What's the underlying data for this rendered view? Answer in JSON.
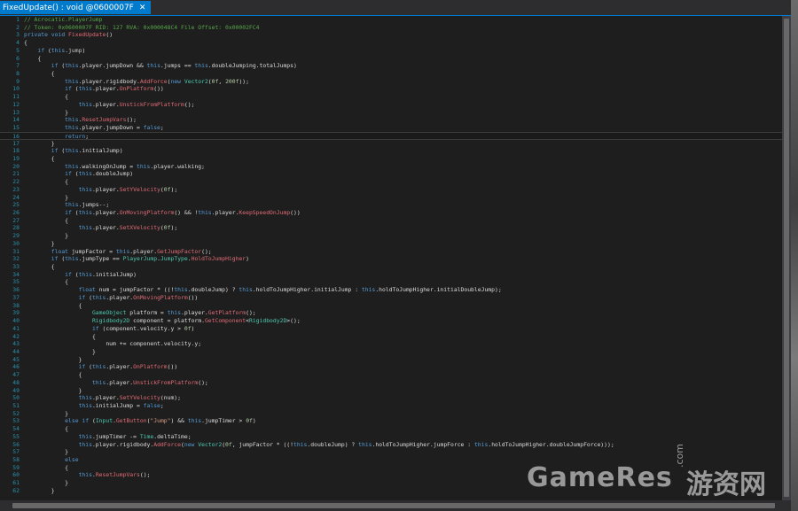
{
  "tab": {
    "title": "FixedUpdate() : void @0600007F",
    "close": "✕"
  },
  "colors": {
    "keyword": "#569cd6",
    "comment": "#57a64a",
    "method": "#e06c75",
    "type": "#4ec9b0",
    "string": "#d69d85",
    "number": "#b5cea8",
    "line_number": "#2b91af",
    "text": "#dcdcdc",
    "accent": "#007acc"
  },
  "current_line": 16,
  "watermark": {
    "text": "GameRes",
    "com": ".com",
    "cn": "游资网"
  },
  "lines": [
    [
      [
        "cm",
        "// Acrocatic.PlayerJump"
      ]
    ],
    [
      [
        "cm",
        "// Token: 0x0600007F RID: 127 RVA: 0x000048C4 File Offset: 0x00002FC4"
      ]
    ],
    [
      [
        "kw",
        "private "
      ],
      [
        "kw",
        "void "
      ],
      [
        "mt",
        "FixedUpdate"
      ],
      [
        "pl",
        "()"
      ]
    ],
    [
      [
        "pl",
        "{"
      ]
    ],
    [
      [
        "pl",
        "    "
      ],
      [
        "kw",
        "if "
      ],
      [
        "pl",
        "("
      ],
      [
        "kw",
        "this"
      ],
      [
        "pl",
        "."
      ],
      [
        "fd",
        "jump"
      ],
      [
        "pl",
        ")"
      ]
    ],
    [
      [
        "pl",
        "    {"
      ]
    ],
    [
      [
        "pl",
        "        "
      ],
      [
        "kw",
        "if "
      ],
      [
        "pl",
        "("
      ],
      [
        "kw",
        "this"
      ],
      [
        "pl",
        ".player.jumpDown && "
      ],
      [
        "kw",
        "this"
      ],
      [
        "pl",
        ".jumps == "
      ],
      [
        "kw",
        "this"
      ],
      [
        "pl",
        ".doubleJumping.totalJumps)"
      ]
    ],
    [
      [
        "pl",
        "        {"
      ]
    ],
    [
      [
        "pl",
        "            "
      ],
      [
        "kw",
        "this"
      ],
      [
        "pl",
        ".player.rigidbody."
      ],
      [
        "mt",
        "AddForce"
      ],
      [
        "pl",
        "("
      ],
      [
        "kw",
        "new "
      ],
      [
        "ty",
        "Vector2"
      ],
      [
        "pl",
        "("
      ],
      [
        "nm",
        "0f"
      ],
      [
        "pl",
        ", "
      ],
      [
        "nm",
        "200f"
      ],
      [
        "pl",
        "));"
      ]
    ],
    [
      [
        "pl",
        "            "
      ],
      [
        "kw",
        "if "
      ],
      [
        "pl",
        "("
      ],
      [
        "kw",
        "this"
      ],
      [
        "pl",
        ".player."
      ],
      [
        "mt",
        "OnPlatform"
      ],
      [
        "pl",
        "())"
      ]
    ],
    [
      [
        "pl",
        "            {"
      ]
    ],
    [
      [
        "pl",
        "                "
      ],
      [
        "kw",
        "this"
      ],
      [
        "pl",
        ".player."
      ],
      [
        "mt",
        "UnstickFromPlatform"
      ],
      [
        "pl",
        "();"
      ]
    ],
    [
      [
        "pl",
        "            }"
      ]
    ],
    [
      [
        "pl",
        "            "
      ],
      [
        "kw",
        "this"
      ],
      [
        "pl",
        "."
      ],
      [
        "mt",
        "ResetJumpVars"
      ],
      [
        "pl",
        "();"
      ]
    ],
    [
      [
        "pl",
        "            "
      ],
      [
        "kw",
        "this"
      ],
      [
        "pl",
        ".player.jumpDown = "
      ],
      [
        "kw",
        "false"
      ],
      [
        "pl",
        ";"
      ]
    ],
    [
      [
        "pl",
        "            "
      ],
      [
        "kw",
        "return"
      ],
      [
        "pl",
        ";"
      ]
    ],
    [
      [
        "pl",
        "        }"
      ]
    ],
    [
      [
        "pl",
        "        "
      ],
      [
        "kw",
        "if "
      ],
      [
        "pl",
        "("
      ],
      [
        "kw",
        "this"
      ],
      [
        "pl",
        ".initialJump)"
      ]
    ],
    [
      [
        "pl",
        "        {"
      ]
    ],
    [
      [
        "pl",
        "            "
      ],
      [
        "kw",
        "this"
      ],
      [
        "pl",
        ".walkingOnJump = "
      ],
      [
        "kw",
        "this"
      ],
      [
        "pl",
        ".player.walking;"
      ]
    ],
    [
      [
        "pl",
        "            "
      ],
      [
        "kw",
        "if "
      ],
      [
        "pl",
        "("
      ],
      [
        "kw",
        "this"
      ],
      [
        "pl",
        ".doubleJump)"
      ]
    ],
    [
      [
        "pl",
        "            {"
      ]
    ],
    [
      [
        "pl",
        "                "
      ],
      [
        "kw",
        "this"
      ],
      [
        "pl",
        ".player."
      ],
      [
        "mt",
        "SetYVelocity"
      ],
      [
        "pl",
        "("
      ],
      [
        "nm",
        "0f"
      ],
      [
        "pl",
        ");"
      ]
    ],
    [
      [
        "pl",
        "            }"
      ]
    ],
    [
      [
        "pl",
        "            "
      ],
      [
        "kw",
        "this"
      ],
      [
        "pl",
        ".jumps--;"
      ]
    ],
    [
      [
        "pl",
        "            "
      ],
      [
        "kw",
        "if "
      ],
      [
        "pl",
        "("
      ],
      [
        "kw",
        "this"
      ],
      [
        "pl",
        ".player."
      ],
      [
        "mt",
        "OnMovingPlatform"
      ],
      [
        "pl",
        "() && !"
      ],
      [
        "kw",
        "this"
      ],
      [
        "pl",
        ".player."
      ],
      [
        "mt",
        "KeepSpeedOnJump"
      ],
      [
        "pl",
        "())"
      ]
    ],
    [
      [
        "pl",
        "            {"
      ]
    ],
    [
      [
        "pl",
        "                "
      ],
      [
        "kw",
        "this"
      ],
      [
        "pl",
        ".player."
      ],
      [
        "mt",
        "SetXVelocity"
      ],
      [
        "pl",
        "("
      ],
      [
        "nm",
        "0f"
      ],
      [
        "pl",
        ");"
      ]
    ],
    [
      [
        "pl",
        "            }"
      ]
    ],
    [
      [
        "pl",
        "        }"
      ]
    ],
    [
      [
        "pl",
        "        "
      ],
      [
        "kw",
        "float "
      ],
      [
        "pl",
        "jumpFactor = "
      ],
      [
        "kw",
        "this"
      ],
      [
        "pl",
        ".player."
      ],
      [
        "mt",
        "GetJumpFactor"
      ],
      [
        "pl",
        "();"
      ]
    ],
    [
      [
        "pl",
        "        "
      ],
      [
        "kw",
        "if "
      ],
      [
        "pl",
        "("
      ],
      [
        "kw",
        "this"
      ],
      [
        "pl",
        ".jumpType == "
      ],
      [
        "ty",
        "PlayerJump"
      ],
      [
        "pl",
        "."
      ],
      [
        "ty",
        "JumpType"
      ],
      [
        "pl",
        "."
      ],
      [
        "mt",
        "HoldToJumpHigher"
      ],
      [
        "pl",
        ")"
      ]
    ],
    [
      [
        "pl",
        "        {"
      ]
    ],
    [
      [
        "pl",
        "            "
      ],
      [
        "kw",
        "if "
      ],
      [
        "pl",
        "("
      ],
      [
        "kw",
        "this"
      ],
      [
        "pl",
        ".initialJump)"
      ]
    ],
    [
      [
        "pl",
        "            {"
      ]
    ],
    [
      [
        "pl",
        "                "
      ],
      [
        "kw",
        "float "
      ],
      [
        "pl",
        "num = jumpFactor * ((!"
      ],
      [
        "kw",
        "this"
      ],
      [
        "pl",
        ".doubleJump) ? "
      ],
      [
        "kw",
        "this"
      ],
      [
        "pl",
        ".holdToJumpHigher.initialJump : "
      ],
      [
        "kw",
        "this"
      ],
      [
        "pl",
        ".holdToJumpHigher.initialDoubleJump);"
      ]
    ],
    [
      [
        "pl",
        "                "
      ],
      [
        "kw",
        "if "
      ],
      [
        "pl",
        "("
      ],
      [
        "kw",
        "this"
      ],
      [
        "pl",
        ".player."
      ],
      [
        "mt",
        "OnMovingPlatform"
      ],
      [
        "pl",
        "())"
      ]
    ],
    [
      [
        "pl",
        "                {"
      ]
    ],
    [
      [
        "pl",
        "                    "
      ],
      [
        "ty",
        "GameObject "
      ],
      [
        "pl",
        "platform = "
      ],
      [
        "kw",
        "this"
      ],
      [
        "pl",
        ".player."
      ],
      [
        "mt",
        "GetPlatform"
      ],
      [
        "pl",
        "();"
      ]
    ],
    [
      [
        "pl",
        "                    "
      ],
      [
        "ty",
        "Rigidbody2D "
      ],
      [
        "pl",
        "component = platform."
      ],
      [
        "mt",
        "GetComponent"
      ],
      [
        "pl",
        "<"
      ],
      [
        "ty",
        "Rigidbody2D"
      ],
      [
        "pl",
        ">();"
      ]
    ],
    [
      [
        "pl",
        "                    "
      ],
      [
        "kw",
        "if "
      ],
      [
        "pl",
        "(component.velocity.y > "
      ],
      [
        "nm",
        "0f"
      ],
      [
        "pl",
        ")"
      ]
    ],
    [
      [
        "pl",
        "                    {"
      ]
    ],
    [
      [
        "pl",
        "                        num += component.velocity.y;"
      ]
    ],
    [
      [
        "pl",
        "                    }"
      ]
    ],
    [
      [
        "pl",
        "                }"
      ]
    ],
    [
      [
        "pl",
        "                "
      ],
      [
        "kw",
        "if "
      ],
      [
        "pl",
        "("
      ],
      [
        "kw",
        "this"
      ],
      [
        "pl",
        ".player."
      ],
      [
        "mt",
        "OnPlatform"
      ],
      [
        "pl",
        "())"
      ]
    ],
    [
      [
        "pl",
        "                {"
      ]
    ],
    [
      [
        "pl",
        "                    "
      ],
      [
        "kw",
        "this"
      ],
      [
        "pl",
        ".player."
      ],
      [
        "mt",
        "UnstickFromPlatform"
      ],
      [
        "pl",
        "();"
      ]
    ],
    [
      [
        "pl",
        "                }"
      ]
    ],
    [
      [
        "pl",
        "                "
      ],
      [
        "kw",
        "this"
      ],
      [
        "pl",
        ".player."
      ],
      [
        "mt",
        "SetYVelocity"
      ],
      [
        "pl",
        "(num);"
      ]
    ],
    [
      [
        "pl",
        "                "
      ],
      [
        "kw",
        "this"
      ],
      [
        "pl",
        ".initialJump = "
      ],
      [
        "kw",
        "false"
      ],
      [
        "pl",
        ";"
      ]
    ],
    [
      [
        "pl",
        "            }"
      ]
    ],
    [
      [
        "pl",
        "            "
      ],
      [
        "kw",
        "else if "
      ],
      [
        "pl",
        "("
      ],
      [
        "ty",
        "Input"
      ],
      [
        "pl",
        "."
      ],
      [
        "mt",
        "GetButton"
      ],
      [
        "pl",
        "("
      ],
      [
        "st",
        "\"Jump\""
      ],
      [
        "pl",
        ") && "
      ],
      [
        "kw",
        "this"
      ],
      [
        "pl",
        ".jumpTimer > "
      ],
      [
        "nm",
        "0f"
      ],
      [
        "pl",
        ")"
      ]
    ],
    [
      [
        "pl",
        "            {"
      ]
    ],
    [
      [
        "pl",
        "                "
      ],
      [
        "kw",
        "this"
      ],
      [
        "pl",
        ".jumpTimer -= "
      ],
      [
        "ty",
        "Time"
      ],
      [
        "pl",
        ".deltaTime;"
      ]
    ],
    [
      [
        "pl",
        "                "
      ],
      [
        "kw",
        "this"
      ],
      [
        "pl",
        ".player.rigidbody."
      ],
      [
        "mt",
        "AddForce"
      ],
      [
        "pl",
        "("
      ],
      [
        "kw",
        "new "
      ],
      [
        "ty",
        "Vector2"
      ],
      [
        "pl",
        "("
      ],
      [
        "nm",
        "0f"
      ],
      [
        "pl",
        ", jumpFactor * ((!"
      ],
      [
        "kw",
        "this"
      ],
      [
        "pl",
        ".doubleJump) ? "
      ],
      [
        "kw",
        "this"
      ],
      [
        "pl",
        ".holdToJumpHigher.jumpForce : "
      ],
      [
        "kw",
        "this"
      ],
      [
        "pl",
        ".holdToJumpHigher.doubleJumpForce)));"
      ]
    ],
    [
      [
        "pl",
        "            }"
      ]
    ],
    [
      [
        "pl",
        "            "
      ],
      [
        "kw",
        "else"
      ]
    ],
    [
      [
        "pl",
        "            {"
      ]
    ],
    [
      [
        "pl",
        "                "
      ],
      [
        "kw",
        "this"
      ],
      [
        "pl",
        "."
      ],
      [
        "mt",
        "ResetJumpVars"
      ],
      [
        "pl",
        "();"
      ]
    ],
    [
      [
        "pl",
        "            }"
      ]
    ],
    [
      [
        "pl",
        "        }"
      ]
    ]
  ]
}
